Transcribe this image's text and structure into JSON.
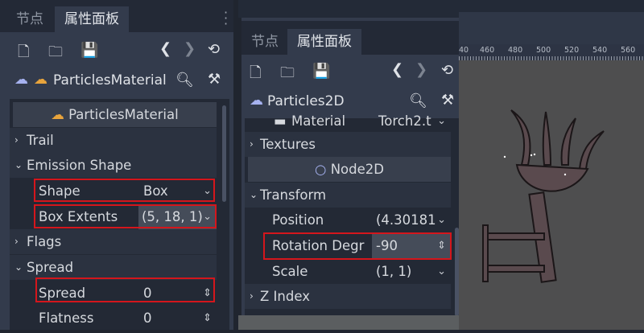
{
  "left_panel": {
    "tabs": [
      "节点",
      "属性面板"
    ],
    "active_tab": 1,
    "resource_title": "ParticlesMaterial",
    "section_title": "ParticlesMaterial",
    "rows": [
      {
        "type": "group",
        "label": "Trail",
        "expanded": false
      },
      {
        "type": "group",
        "label": "Emission Shape",
        "expanded": true
      },
      {
        "type": "prop",
        "label": "Shape",
        "value": "Box",
        "control": "dropdown",
        "highlighted": true
      },
      {
        "type": "prop",
        "label": "Box Extents",
        "value": "(5, 18, 1)",
        "control": "dropdown",
        "highlighted": true
      },
      {
        "type": "group",
        "label": "Flags",
        "expanded": false
      },
      {
        "type": "group",
        "label": "Spread",
        "expanded": true
      },
      {
        "type": "prop",
        "label": "Spread",
        "value": "0",
        "control": "spinner",
        "highlighted": true
      },
      {
        "type": "prop",
        "label": "Flatness",
        "value": "0",
        "control": "spinner",
        "highlighted": false
      }
    ]
  },
  "right_panel": {
    "tabs": [
      "节点",
      "属性面板"
    ],
    "active_tab": 1,
    "node_title": "Particles2D",
    "partial_row": {
      "label": "Material",
      "value": "Torch2.t"
    },
    "rows": [
      {
        "type": "group",
        "label": "Textures",
        "expanded": false
      },
      {
        "type": "category",
        "label": "Node2D"
      },
      {
        "type": "group",
        "label": "Transform",
        "expanded": true
      },
      {
        "type": "prop",
        "label": "Position",
        "value": "(4.30181",
        "control": "dropdown",
        "highlighted": false
      },
      {
        "type": "prop",
        "label": "Rotation Degr",
        "value": "-90",
        "control": "spinner",
        "highlighted": true
      },
      {
        "type": "prop",
        "label": "Scale",
        "value": "(1, 1)",
        "control": "dropdown",
        "highlighted": false
      },
      {
        "type": "group",
        "label": "Z Index",
        "expanded": false
      }
    ]
  },
  "ruler": {
    "ticks": [
      "40",
      "460",
      "480",
      "500",
      "520",
      "540",
      "560"
    ]
  },
  "colors": {
    "highlight": "#d4161c",
    "panel": "#333b4c",
    "inspector": "#232935",
    "viewport": "#4e4e4f"
  }
}
